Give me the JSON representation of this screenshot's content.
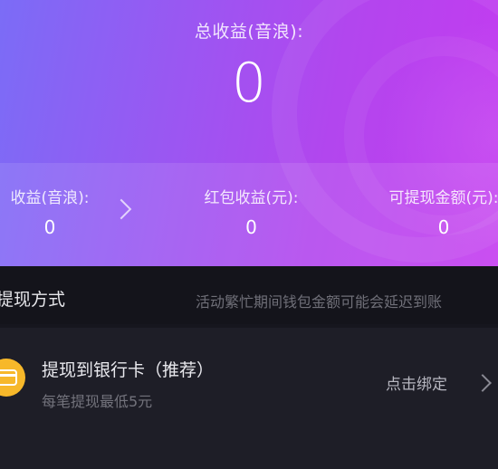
{
  "summary": {
    "total_label": "总收益(音浪):",
    "total_value": "0"
  },
  "stats": [
    {
      "label": "收益(音浪):",
      "value": "0"
    },
    {
      "label": "红包收益(元):",
      "value": "0"
    },
    {
      "label": "可提现金额(元):",
      "value": "0"
    }
  ],
  "withdraw_section": {
    "title": "提现方式",
    "notice": "活动繁忙期间钱包金额可能会延迟到账"
  },
  "methods": [
    {
      "title": "提现到银行卡（推荐）",
      "subtitle": "每笔提现最低5元",
      "action": "点击绑定",
      "icon": "bank-card-icon",
      "icon_color": "#f7b82a"
    }
  ],
  "colors": {
    "accent_gradient_start": "#7b6cf6",
    "accent_gradient_end": "#c43bf0",
    "background": "#16161e"
  }
}
